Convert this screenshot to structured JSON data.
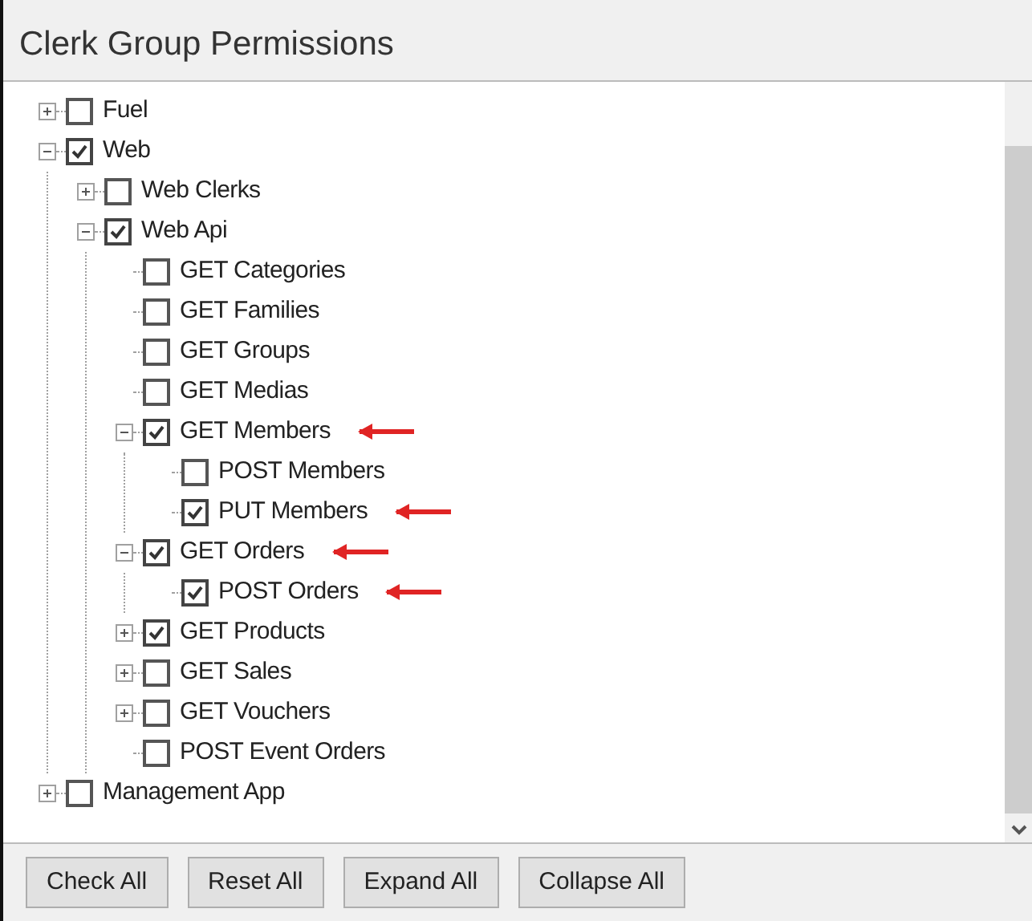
{
  "title": "Clerk Group Permissions",
  "tree": [
    {
      "label": "Fuel",
      "checked": false,
      "expanded": false,
      "marked": false
    },
    {
      "label": "Web",
      "checked": true,
      "expanded": true,
      "marked": false,
      "children": [
        {
          "label": "Web Clerks",
          "checked": false,
          "expanded": false,
          "marked": false
        },
        {
          "label": "Web Api",
          "checked": true,
          "expanded": true,
          "marked": false,
          "children": [
            {
              "label": "GET Categories",
              "checked": false,
              "marked": false
            },
            {
              "label": "GET Families",
              "checked": false,
              "marked": false
            },
            {
              "label": "GET Groups",
              "checked": false,
              "marked": false
            },
            {
              "label": "GET Medias",
              "checked": false,
              "marked": false
            },
            {
              "label": "GET Members",
              "checked": true,
              "expanded": true,
              "marked": true,
              "children": [
                {
                  "label": "POST Members",
                  "checked": false,
                  "marked": false
                },
                {
                  "label": "PUT Members",
                  "checked": true,
                  "marked": true
                }
              ]
            },
            {
              "label": "GET Orders",
              "checked": true,
              "expanded": true,
              "marked": true,
              "children": [
                {
                  "label": "POST Orders",
                  "checked": true,
                  "marked": true
                }
              ]
            },
            {
              "label": "GET Products",
              "checked": true,
              "expanded": false,
              "marked": false
            },
            {
              "label": "GET Sales",
              "checked": false,
              "expanded": false,
              "marked": false
            },
            {
              "label": "GET Vouchers",
              "checked": false,
              "expanded": false,
              "marked": false
            },
            {
              "label": "POST Event Orders",
              "checked": false,
              "marked": false
            }
          ]
        }
      ]
    },
    {
      "label": "Management App",
      "checked": false,
      "expanded": false,
      "marked": false
    }
  ],
  "buttons": [
    "Check All",
    "Reset All",
    "Expand All",
    "Collapse All"
  ]
}
